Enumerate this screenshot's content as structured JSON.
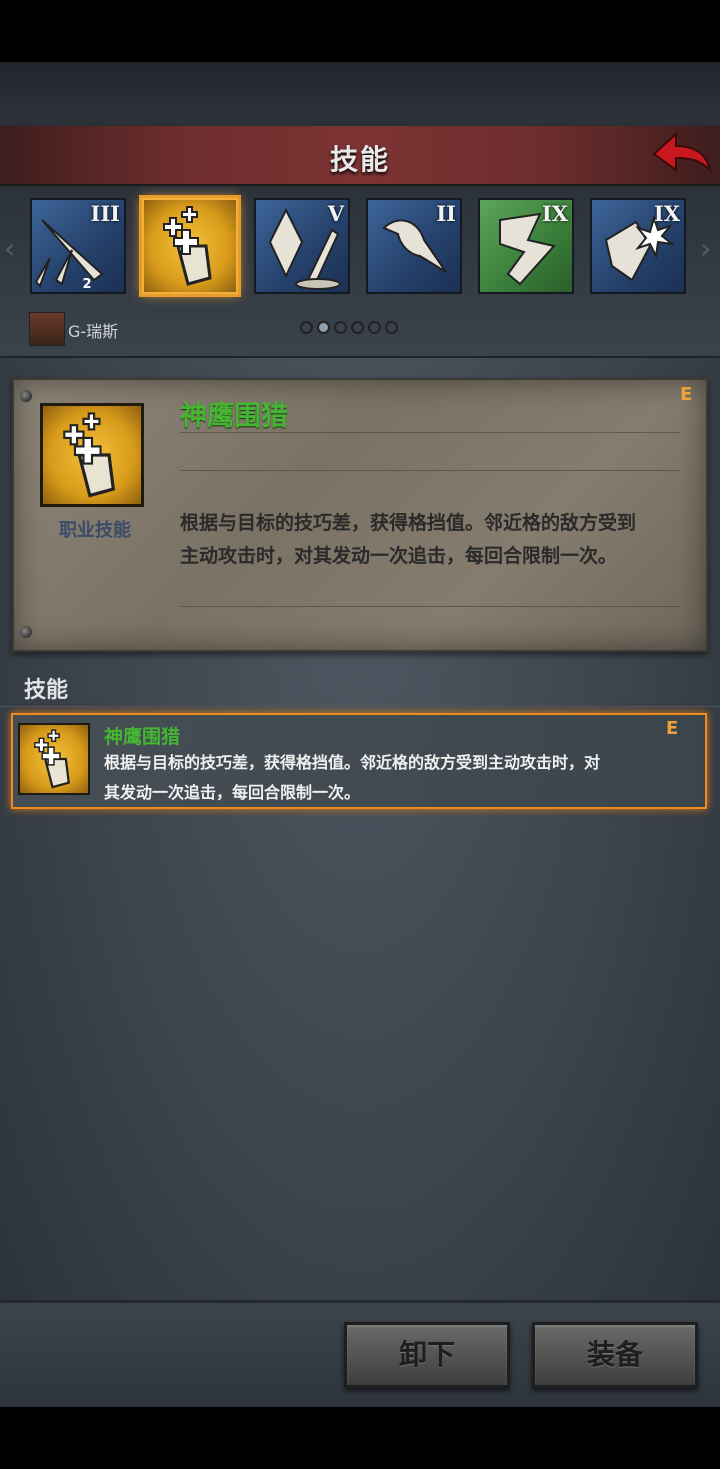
{
  "header": {
    "title": "技能"
  },
  "skill_strip": {
    "icons": [
      {
        "name": "sword-icon",
        "rank": "III",
        "color": "blue",
        "level": "2"
      },
      {
        "name": "gauntlet-icon",
        "rank": "",
        "color": "gold",
        "selected": true
      },
      {
        "name": "crystal-icon",
        "rank": "V",
        "color": "blue"
      },
      {
        "name": "hawk-icon",
        "rank": "II",
        "color": "blue"
      },
      {
        "name": "stone-icon",
        "rank": "IX",
        "color": "green"
      },
      {
        "name": "burst-icon",
        "rank": "IX",
        "color": "blue"
      }
    ],
    "character_name": "G-瑞斯",
    "page_count": 6,
    "active_page": 1
  },
  "detail": {
    "skill_name": "神鹰围猎",
    "grade": "E",
    "class_label": "职业技能",
    "description": "根据与目标的技巧差，获得格挡值。邻近格的敌方受到主动攻击时，对其发动一次追击，每回合限制一次。"
  },
  "skills_section": {
    "title": "技能",
    "items": [
      {
        "name": "神鹰围猎",
        "grade": "E",
        "description": "根据与目标的技巧差，获得格挡值。邻近格的敌方受到主动攻击时，对其发动一次追击，每回合限制一次。"
      }
    ]
  },
  "buttons": {
    "unequip": "卸下",
    "equip": "装备"
  },
  "colors": {
    "accent": "#ef8a1e",
    "skill_name": "#46b632",
    "title_bar": "#7c3333"
  }
}
